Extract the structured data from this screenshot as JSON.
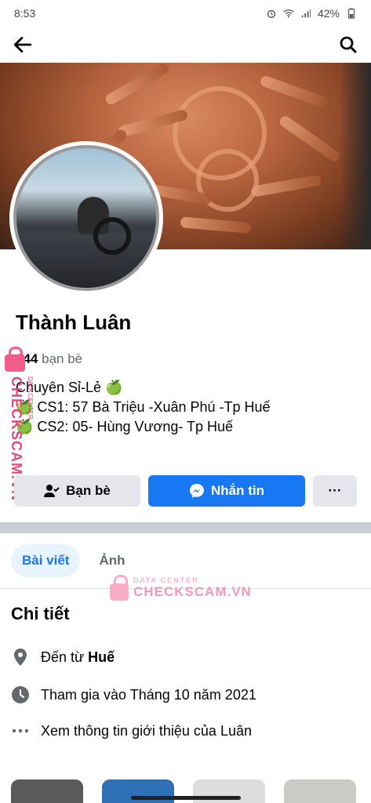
{
  "status_bar": {
    "time": "8:53",
    "battery": "42%"
  },
  "profile": {
    "name": "Thành Luân",
    "friends_count": "844",
    "friends_suffix": "bạn bè",
    "bio": [
      "Chuyên Sỉ-Lẻ 🍏",
      "🍏 CS1: 57 Bà Triệu -Xuân Phú -Tp Huế",
      "🍏 CS2: 05- Hùng Vương- Tp Huế"
    ]
  },
  "actions": {
    "friends_label": "Bạn bè",
    "message_label": "Nhắn tin",
    "more_label": "···"
  },
  "tabs": [
    {
      "label": "Bài viết",
      "active": true
    },
    {
      "label": "Ảnh",
      "active": false
    }
  ],
  "details": {
    "title": "Chi tiết",
    "from_prefix": "Đến từ",
    "from_place": "Huế",
    "joined": "Tham gia vào Tháng 10 năm 2021",
    "about": "Xem thông tin giới thiệu của Luân"
  },
  "watermark": {
    "top_text": "DATA CENTER",
    "brand": "CHECKSCAM.VN"
  },
  "colors": {
    "accent": "#1877f2",
    "watermark": "#e8457a"
  }
}
